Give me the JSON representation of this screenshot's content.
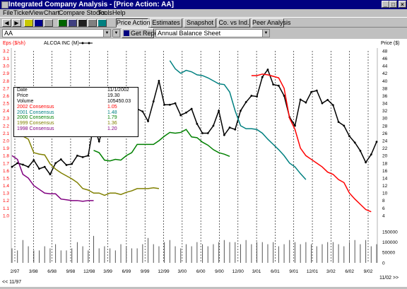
{
  "window": {
    "title": "Integrated Company Analysis - [Price Action:  AA]",
    "controls": [
      "_",
      "□",
      "×"
    ]
  },
  "menu": [
    "File",
    "Ticker",
    "View",
    "Chart",
    "Compare Stocks...",
    "Tools",
    "Help"
  ],
  "toolbar": {
    "icons": [
      "back-arrow-icon",
      "forward-arrow-icon",
      "open-icon",
      "save-icon",
      "print-icon",
      "grid-icon",
      "table-icon",
      "chart-icon",
      "copy-icon",
      "help-icon"
    ],
    "tabs": [
      {
        "label": "Price Action",
        "pressed": true
      },
      {
        "label": "Estimates",
        "pressed": false
      },
      {
        "label": "Snapshot",
        "pressed": false
      },
      {
        "label": "Co. vs Ind.",
        "pressed": false
      },
      {
        "label": "Peer Analysis",
        "pressed": false
      }
    ]
  },
  "ticker_input": {
    "value": "AA"
  },
  "report_combo": {
    "value": ""
  },
  "get_report": {
    "label": "Get Report"
  },
  "report_type": {
    "value": "Annual Balance Sheet"
  },
  "chart_header": {
    "left_axis_label": "Eps ($/sh)",
    "legend": "ALCOA INC (M)",
    "right_axis_label": "Price ($)"
  },
  "info": {
    "rows": [
      {
        "label": "Date",
        "value": "11/1/2002",
        "color": "#000000"
      },
      {
        "label": "Price",
        "value": "19.30",
        "color": "#000000"
      },
      {
        "label": "Volume",
        "value": "105450.03",
        "color": "#000000"
      },
      {
        "label": "2002 Consensus",
        "value": "1.05",
        "color": "#ff0000"
      },
      {
        "label": "2001 Consensus",
        "value": "1.48",
        "color": "#008080"
      },
      {
        "label": "2000 Consensus",
        "value": "1.79",
        "color": "#008000"
      },
      {
        "label": "1999 Consensus",
        "value": "1.36",
        "color": "#808000"
      },
      {
        "label": "1998 Consensus",
        "value": "1.20",
        "color": "#800080"
      }
    ]
  },
  "nav": {
    "prev": "<< 11/97",
    "next": "11/02 >>"
  },
  "chart_data": {
    "type": "line",
    "left_axis": {
      "label": "Eps ($/sh)",
      "min": 1.0,
      "max": 3.2,
      "ticks": [
        "1.0",
        "1.1",
        "1.2",
        "1.3",
        "1.4",
        "1.5",
        "1.6",
        "1.7",
        "1.8",
        "1.9",
        "2.0",
        "2.1",
        "2.2",
        "2.3",
        "2.4",
        "2.5",
        "2.6",
        "2.7",
        "2.8",
        "2.9",
        "3.0",
        "3.1",
        "3.2"
      ]
    },
    "right_axis": {
      "label": "Price ($)",
      "min": 4,
      "max": 48,
      "ticks": [
        "4",
        "6",
        "8",
        "10",
        "12",
        "14",
        "16",
        "18",
        "20",
        "22",
        "24",
        "26",
        "28",
        "30",
        "32",
        "34",
        "36",
        "38",
        "40",
        "42",
        "44",
        "46",
        "48"
      ]
    },
    "volume_axis": {
      "ticks": [
        "150000",
        "100000",
        "50000",
        "0"
      ]
    },
    "x_ticks": [
      "2/97",
      "3/98",
      "6/98",
      "9/98",
      "12/98",
      "3/99",
      "6/99",
      "9/99",
      "12/99",
      "3/00",
      "6/00",
      "9/00",
      "12/00",
      "3/01",
      "6/01",
      "9/01",
      "12/01",
      "3/02",
      "6/02",
      "9/02"
    ],
    "series": [
      {
        "name": "Price",
        "color": "#000000",
        "points": [
          [
            0,
            17
          ],
          [
            1,
            18
          ],
          [
            2,
            17.6
          ],
          [
            3,
            17
          ],
          [
            4,
            18.8
          ],
          [
            5,
            16.5
          ],
          [
            6,
            17
          ],
          [
            7,
            15
          ],
          [
            8,
            18
          ],
          [
            9,
            19
          ],
          [
            10,
            17.5
          ],
          [
            11,
            17.8
          ],
          [
            12,
            20
          ],
          [
            13,
            19.6
          ],
          [
            14,
            20
          ],
          [
            15,
            28.3
          ],
          [
            16,
            23.8
          ],
          [
            17,
            28.8
          ],
          [
            18,
            29.8
          ],
          [
            19,
            27.6
          ],
          [
            20,
            29
          ],
          [
            21,
            31
          ],
          [
            22,
            28.5
          ],
          [
            23,
            32.5
          ],
          [
            24,
            31.8
          ],
          [
            25,
            29.2
          ],
          [
            26,
            34.5
          ],
          [
            27,
            40
          ],
          [
            28,
            33.6
          ],
          [
            29,
            33.6
          ],
          [
            30,
            34
          ],
          [
            31,
            30.8
          ],
          [
            32,
            31.5
          ],
          [
            33,
            32.5
          ],
          [
            34,
            28.5
          ],
          [
            35,
            26
          ],
          [
            36,
            26
          ],
          [
            37,
            28
          ],
          [
            38,
            32
          ],
          [
            39,
            25.5
          ],
          [
            40,
            27.5
          ],
          [
            41,
            27
          ],
          [
            42,
            32
          ],
          [
            43,
            34.3
          ],
          [
            44,
            36
          ],
          [
            45,
            35.8
          ],
          [
            46,
            41
          ],
          [
            47,
            43
          ],
          [
            48,
            39
          ],
          [
            49,
            38.7
          ],
          [
            50,
            36
          ],
          [
            51,
            30.3
          ],
          [
            52,
            28
          ],
          [
            53,
            35
          ],
          [
            54,
            34.2
          ],
          [
            55,
            37
          ],
          [
            56,
            37.4
          ],
          [
            57,
            34
          ],
          [
            58,
            34.9
          ],
          [
            59,
            33.5
          ],
          [
            60,
            29
          ],
          [
            61,
            28
          ],
          [
            62,
            25.2
          ],
          [
            63,
            23.5
          ],
          [
            64,
            21.3
          ],
          [
            65,
            18.2
          ],
          [
            66,
            20.3
          ],
          [
            67,
            23.7
          ]
        ]
      },
      {
        "name": "2002 Consensus",
        "color": "#ff0000",
        "points": [
          [
            44,
            2.87
          ],
          [
            45,
            2.87
          ],
          [
            46,
            2.89
          ],
          [
            47,
            2.88
          ],
          [
            48,
            2.86
          ],
          [
            49,
            2.84
          ],
          [
            50,
            2.7
          ],
          [
            51,
            2.3
          ],
          [
            52,
            2.15
          ],
          [
            53,
            1.9
          ],
          [
            54,
            1.8
          ],
          [
            55,
            1.75
          ],
          [
            56,
            1.7
          ],
          [
            57,
            1.65
          ],
          [
            58,
            1.58
          ],
          [
            59,
            1.55
          ],
          [
            60,
            1.48
          ],
          [
            61,
            1.44
          ],
          [
            62,
            1.3
          ],
          [
            63,
            1.22
          ],
          [
            64,
            1.15
          ],
          [
            65,
            1.08
          ],
          [
            66,
            1.05
          ]
        ]
      },
      {
        "name": "2001 Consensus",
        "color": "#008080",
        "points": [
          [
            29,
            3.07
          ],
          [
            30,
            2.96
          ],
          [
            31,
            2.9
          ],
          [
            32,
            2.94
          ],
          [
            33,
            2.92
          ],
          [
            34,
            2.88
          ],
          [
            35,
            2.87
          ],
          [
            36,
            2.84
          ],
          [
            37,
            2.8
          ],
          [
            38,
            2.76
          ],
          [
            39,
            2.75
          ],
          [
            40,
            2.65
          ],
          [
            41,
            2.4
          ],
          [
            42,
            2.2
          ],
          [
            43,
            2.16
          ],
          [
            44,
            2.16
          ],
          [
            45,
            2.15
          ],
          [
            46,
            2.1
          ],
          [
            47,
            2.02
          ],
          [
            48,
            1.95
          ],
          [
            49,
            1.88
          ],
          [
            50,
            1.8
          ],
          [
            51,
            1.7
          ],
          [
            52,
            1.65
          ],
          [
            53,
            1.56
          ],
          [
            54,
            1.48
          ]
        ]
      },
      {
        "name": "2000 Consensus",
        "color": "#008000",
        "points": [
          [
            15,
            1.87
          ],
          [
            16,
            1.84
          ],
          [
            17,
            1.74
          ],
          [
            18,
            1.73
          ],
          [
            19,
            1.75
          ],
          [
            20,
            1.74
          ],
          [
            21,
            1.8
          ],
          [
            22,
            1.84
          ],
          [
            23,
            1.95
          ],
          [
            24,
            1.95
          ],
          [
            25,
            1.95
          ],
          [
            26,
            1.95
          ],
          [
            27,
            2.0
          ],
          [
            28,
            2.06
          ],
          [
            29,
            2.11
          ],
          [
            30,
            2.1
          ],
          [
            31,
            2.11
          ],
          [
            32,
            2.15
          ],
          [
            33,
            2.05
          ],
          [
            34,
            2.04
          ],
          [
            35,
            1.98
          ],
          [
            36,
            1.94
          ],
          [
            37,
            1.88
          ],
          [
            38,
            1.84
          ],
          [
            39,
            1.82
          ],
          [
            40,
            1.79
          ]
        ]
      },
      {
        "name": "1999 Consensus",
        "color": "#808000",
        "points": [
          [
            2,
            2.06
          ],
          [
            3,
            2.02
          ],
          [
            4,
            1.84
          ],
          [
            5,
            1.82
          ],
          [
            6,
            1.81
          ],
          [
            7,
            1.69
          ],
          [
            8,
            1.62
          ],
          [
            9,
            1.57
          ],
          [
            10,
            1.53
          ],
          [
            11,
            1.49
          ],
          [
            12,
            1.44
          ],
          [
            13,
            1.36
          ],
          [
            14,
            1.34
          ],
          [
            15,
            1.3
          ],
          [
            16,
            1.3
          ],
          [
            17,
            1.27
          ],
          [
            18,
            1.3
          ],
          [
            19,
            1.3
          ],
          [
            20,
            1.28
          ],
          [
            21,
            1.31
          ],
          [
            22,
            1.33
          ],
          [
            23,
            1.36
          ],
          [
            24,
            1.36
          ],
          [
            25,
            1.36
          ],
          [
            26,
            1.37
          ],
          [
            27,
            1.36
          ]
        ]
      },
      {
        "name": "1998 Consensus",
        "color": "#800080",
        "points": [
          [
            0,
            1.8
          ],
          [
            1,
            1.75
          ],
          [
            2,
            1.55
          ],
          [
            3,
            1.5
          ],
          [
            4,
            1.4
          ],
          [
            5,
            1.35
          ],
          [
            6,
            1.3
          ],
          [
            7,
            1.29
          ],
          [
            8,
            1.29
          ],
          [
            9,
            1.22
          ],
          [
            10,
            1.21
          ],
          [
            11,
            1.2
          ],
          [
            12,
            1.2
          ],
          [
            13,
            1.19
          ],
          [
            14,
            1.2
          ],
          [
            15,
            1.2
          ]
        ]
      }
    ],
    "volume": [
      70000,
      60000,
      110000,
      80000,
      60000,
      60000,
      80000,
      70000,
      90000,
      60000,
      60000,
      70000,
      100000,
      80000,
      60000,
      130000,
      70000,
      80000,
      70000,
      60000,
      90000,
      80000,
      70000,
      70000,
      90000,
      120000,
      90000,
      80000,
      100000,
      110000,
      80000,
      70000,
      90000,
      80000,
      100000,
      90000,
      80000,
      90000,
      100000,
      110000,
      100000,
      100000,
      90000,
      110000,
      90000,
      100000,
      100000,
      90000,
      100000,
      80000,
      90000,
      110000,
      100000,
      90000,
      100000,
      90000,
      80000,
      90000,
      100000,
      100000,
      90000,
      80000,
      100000,
      110000,
      90000,
      110000,
      80000,
      90000
    ],
    "grid": true
  }
}
